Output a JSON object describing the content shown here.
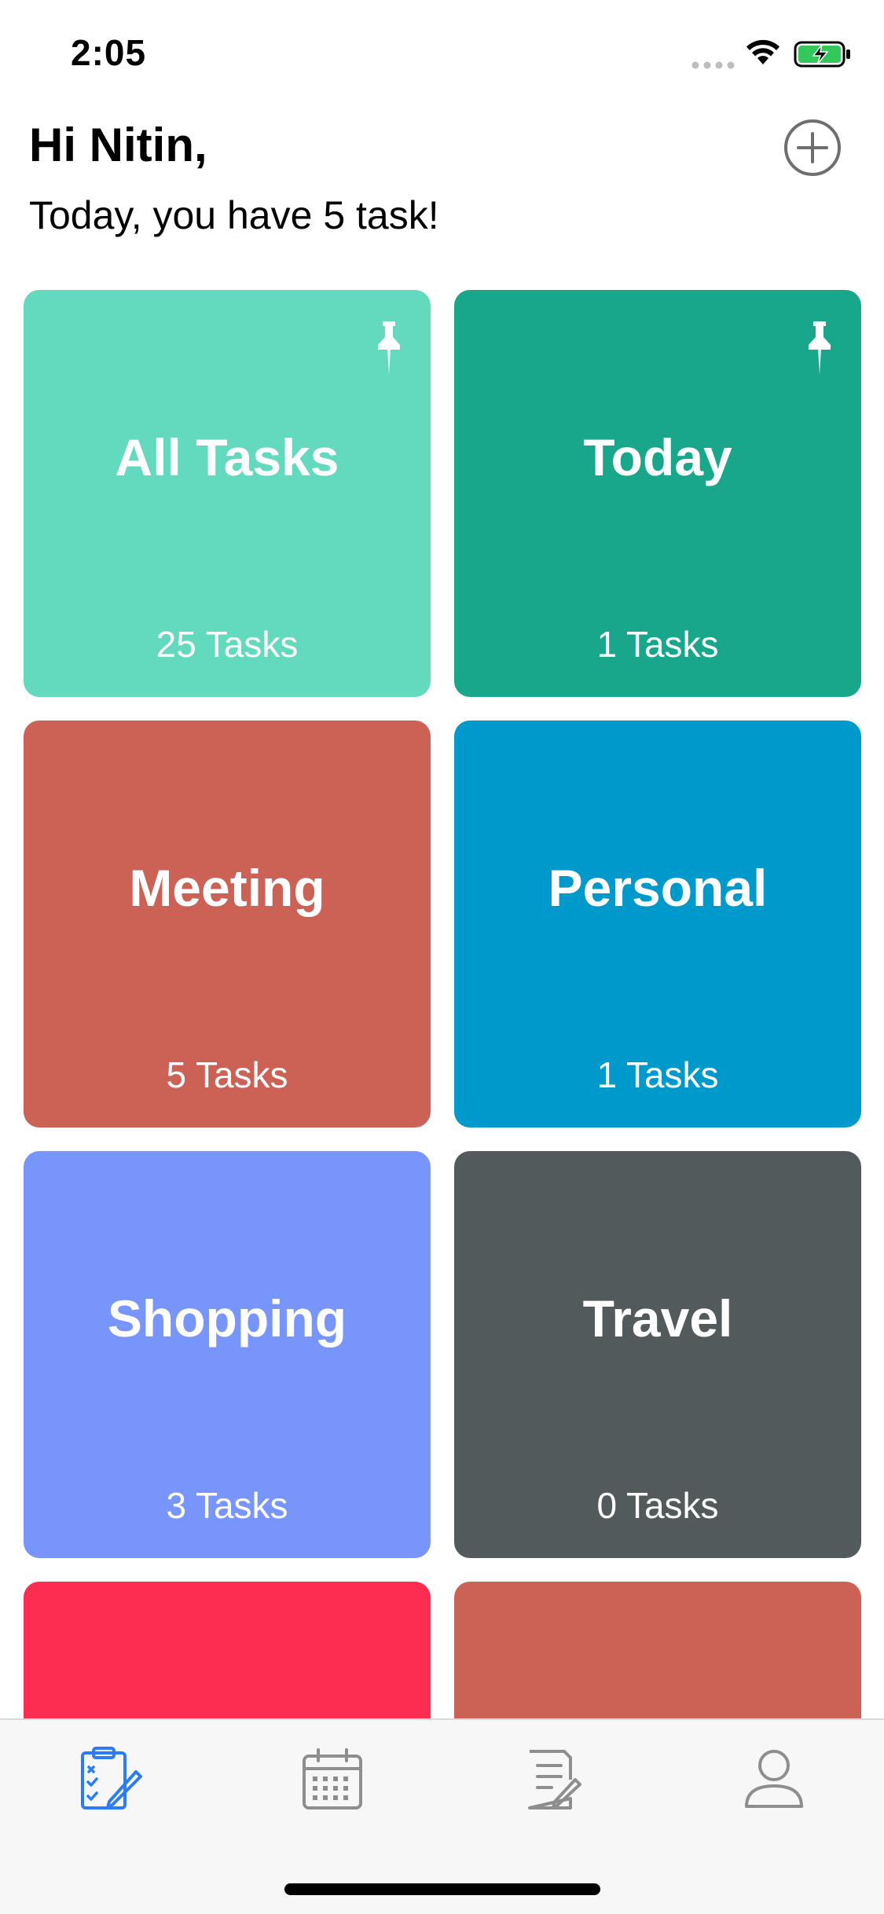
{
  "status_bar": {
    "time": "2:05"
  },
  "header": {
    "greeting": "Hi Nitin,",
    "subtitle": "Today, you have 5 task!",
    "add_icon": "plus-circle-icon"
  },
  "categories": [
    {
      "title": "All Tasks",
      "count": "25 Tasks",
      "color": "#63d9bd",
      "pinned": true
    },
    {
      "title": "Today",
      "count": "1 Tasks",
      "color": "#19a78b",
      "pinned": true
    },
    {
      "title": "Meeting",
      "count": "5 Tasks",
      "color": "#cc6155",
      "pinned": false
    },
    {
      "title": "Personal",
      "count": "1 Tasks",
      "color": "#0099cc",
      "pinned": false
    },
    {
      "title": "Shopping",
      "count": "3 Tasks",
      "color": "#7895fc",
      "pinned": false
    },
    {
      "title": "Travel",
      "count": "0 Tasks",
      "color": "#525a5b",
      "pinned": false
    },
    {
      "title": "",
      "count": "",
      "color": "#fd2c51",
      "pinned": false
    },
    {
      "title": "",
      "count": "",
      "color": "#cc6155",
      "pinned": false
    }
  ],
  "tab_bar": {
    "tabs": [
      {
        "icon": "task-checklist-icon",
        "active": true
      },
      {
        "icon": "calendar-icon",
        "active": false
      },
      {
        "icon": "notes-icon",
        "active": false
      },
      {
        "icon": "profile-icon",
        "active": false
      }
    ],
    "active_color": "#2b7cf6",
    "inactive_color": "#8e8e8e"
  }
}
